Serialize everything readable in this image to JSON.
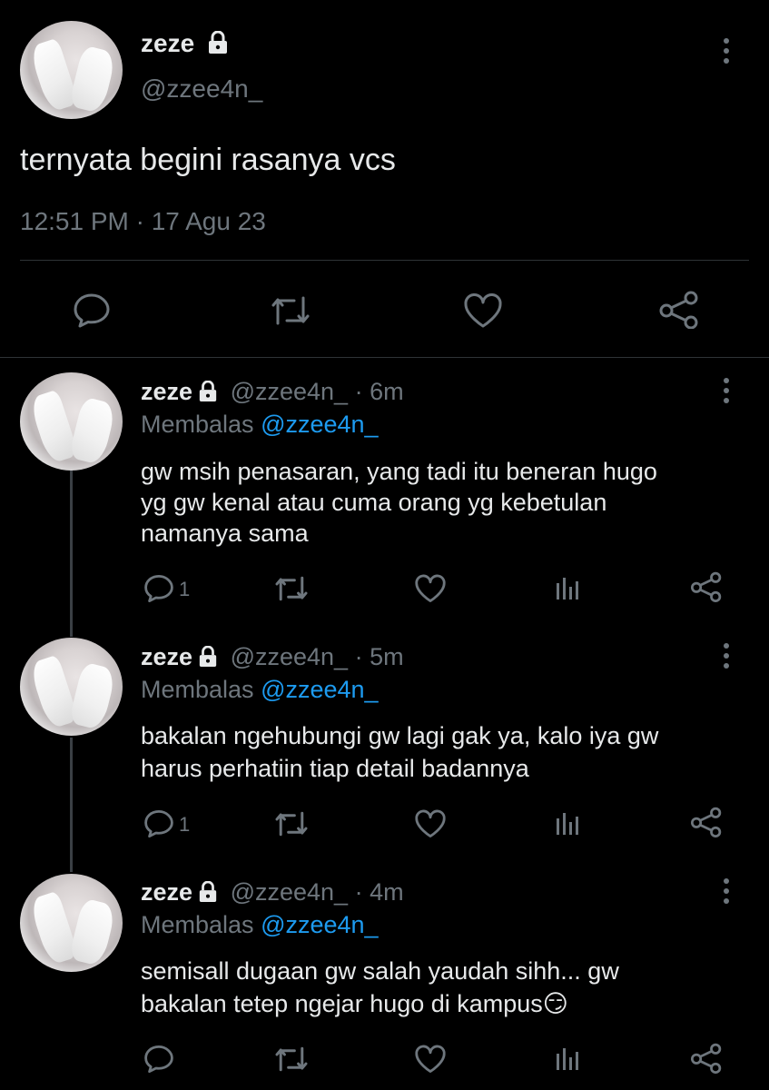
{
  "main_tweet": {
    "display_name": "zeze",
    "handle": "@zzee4n_",
    "text": "ternyata begini rasanya vcs",
    "timestamp": "12:51 PM · 17 Agu 23",
    "actions": [
      "reply-icon",
      "retweet-icon",
      "like-icon",
      "share-icon"
    ]
  },
  "replies": [
    {
      "display_name": "zeze",
      "handle": "@zzee4n_",
      "time": "· 6m",
      "replying_label": "Membalas",
      "replying_to": "@zzee4n_",
      "text_lines": [
        "gw msih penasaran, yang tadi itu beneran hugo",
        "yg gw kenal atau cuma orang yg kebetulan",
        "namanya sama"
      ],
      "reply_count": "1"
    },
    {
      "display_name": "zeze",
      "handle": "@zzee4n_",
      "time": "· 5m",
      "replying_label": "Membalas",
      "replying_to": "@zzee4n_",
      "text_lines": [
        "bakalan ngehubungi gw lagi gak ya, kalo iya gw",
        "harus perhatiin tiap detail badannya"
      ],
      "reply_count": "1"
    },
    {
      "display_name": "zeze",
      "handle": "@zzee4n_",
      "time": "· 4m",
      "replying_label": "Membalas",
      "replying_to": "@zzee4n_",
      "text_lines": [
        "semisall dugaan gw salah yaudah sihh... gw",
        "bakalan tetep ngejar hugo di kampus😏"
      ],
      "reply_count": ""
    }
  ],
  "colors": {
    "background": "#000000",
    "text": "#e7e9ea",
    "muted": "#6e767d",
    "link": "#1d9bf0",
    "divider": "#2f3336"
  }
}
